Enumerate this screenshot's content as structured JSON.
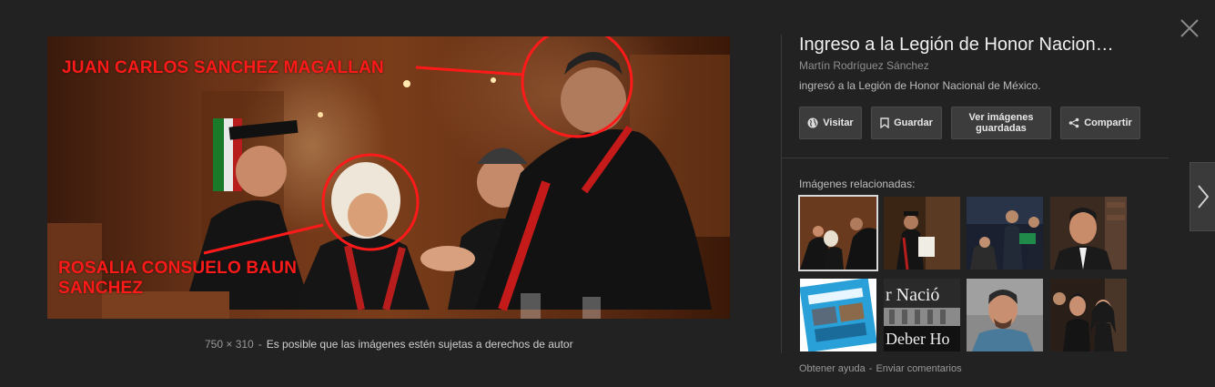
{
  "image": {
    "overlay_top": "JUAN CARLOS SANCHEZ MAGALLAN",
    "overlay_bottom": "ROSALIA CONSUELO BAUN SANCHEZ",
    "dimensions": "750 × 310",
    "rights_notice": "Es posible que las imágenes estén sujetas a derechos de autor"
  },
  "panel": {
    "title": "Ingreso a la Legión de Honor Nacion…",
    "author": "Martín Rodríguez Sánchez",
    "description": "ingresó a la Legión de Honor Nacional de México.",
    "buttons": {
      "visit": "Visitar",
      "save": "Guardar",
      "saved_line1": "Ver imágenes",
      "saved_line2": "guardadas",
      "share": "Compartir"
    },
    "related_heading": "Imágenes relacionadas:",
    "related_thumbs": [
      {
        "text": ""
      },
      {
        "text": ""
      },
      {
        "text": ""
      },
      {
        "text": ""
      },
      {
        "text": ""
      },
      {
        "text": "r Nació"
      },
      {
        "text": ""
      },
      {
        "text": ""
      }
    ],
    "thumb6_bottom_text": "Deber Ho",
    "footer": {
      "help": "Obtener ayuda",
      "feedback": "Enviar comentarios"
    }
  },
  "icons": {
    "close": "close-icon",
    "next": "chevron-right-icon",
    "visit": "globe-icon",
    "save": "bookmark-icon",
    "share": "share-icon"
  },
  "colors": {
    "background": "#222222",
    "overlay_text": "#ff1a1a",
    "button_bg": "#3c3c3c"
  }
}
